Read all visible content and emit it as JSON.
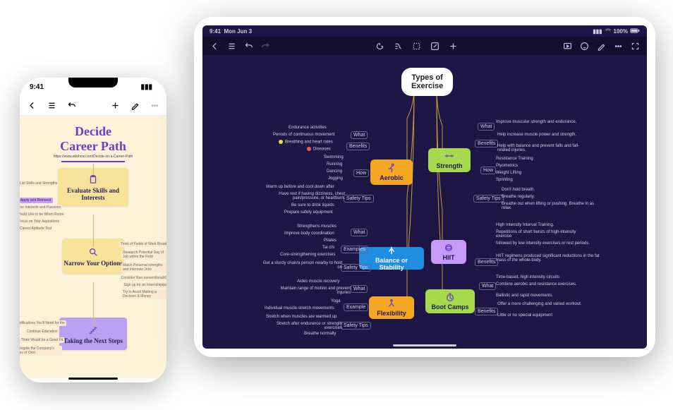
{
  "phone": {
    "status": {
      "time": "9:41"
    },
    "canvas": {
      "title_l1": "Decide",
      "title_l2": "Career Path",
      "url": "https://www.wikihow.com/Decide-on-a-Career-Path",
      "nodes": {
        "n1": "Evaluate Skills and Interests",
        "n2": "Narrow Your Options",
        "n3": "Taking the Next Steps"
      },
      "left": [
        "List Skills and Strengths",
        "Your Interests and Passions",
        "Would Like to be When Retire",
        "Focus on Your Aspirations",
        "Career Aptitude Test"
      ],
      "left_pill": "Apply and Reinvest",
      "right_n2": [
        "Think of Fields of Work Broadly",
        "Research Potential Day of Job within the Field",
        "Match Personal strengths and Interests Jobs",
        "Consider Non-conventional/Go",
        "Sign up for an Internship/part",
        "Try to Avoid Making a Decision & Money"
      ],
      "left_n3": [
        "Continue Education",
        "Qualifications You'll Need for the",
        "You Think Would be a Good Fit",
        "Interrogate the Company's Values of Own"
      ]
    }
  },
  "tablet": {
    "status": {
      "time": "9:41",
      "date": "Mon Jun 3",
      "battery": "100%"
    },
    "canvas": {
      "root_l1": "Types of",
      "root_l2": "Exercise",
      "branches": {
        "aerobic": {
          "label": "Aerobic",
          "what": [
            "Endurance activities",
            "Periods of continuous movement"
          ],
          "benefits": [
            "Breathing and heart rates",
            "Diseases"
          ],
          "how": [
            "Swimming",
            "Running",
            "Dancing",
            "Jogging"
          ],
          "safety": [
            "Warm up before and cool down after",
            "Have rest if having dizziness, chest pain/pressure, or heartburn.",
            "Be sure to drink liquids",
            "Prepare safety equipment"
          ]
        },
        "balance": {
          "label": "Balance or Stability",
          "what": [
            "Strengthens muscles",
            "Improve body coordination"
          ],
          "examples": [
            "Pilates",
            "Tai chi",
            "Core-strengthening exercises"
          ],
          "safety": [
            "Get a sturdy chair/a person nearby to hold on"
          ]
        },
        "flexibility": {
          "label": "Flexibility",
          "what": [
            "Aides muscle recovery",
            "Maintain range of motion and prevent injuries"
          ],
          "example": [
            "Yoga",
            "Individual muscle-stretch movements"
          ],
          "safety": [
            "Stretch when muscles are warmed up",
            "Stretch after endurance or strength exercises",
            "Breathe normally"
          ]
        },
        "strength": {
          "label": "Strength",
          "what": [
            "Improve muscular strength and endurance."
          ],
          "benefits": [
            "Help increase muscle power and strength.",
            "Help with balance and prevent falls and fall-related injuries."
          ],
          "how": [
            "Resistance Training",
            "Plyometrics",
            "Weight Lifting",
            "Sprinting"
          ],
          "safety": [
            "Don't hold breath.",
            "Breathe regularly.",
            "Breathe out when lifting or pushing. Breathe in as relax."
          ]
        },
        "hiit": {
          "label": "HIIT",
          "items": [
            "High Intensity Interval Training.",
            "Repetitions of short bursts of high-intensity exercise",
            "followed by low intensity exercises or rest periods.",
            "HIIT regimens produced significant reductions in the fat mass of the whole-body."
          ]
        },
        "bootcamps": {
          "label": "Boot Camps",
          "what": [
            "Time-based, high intensity circuits",
            "Combine aerobic and resistance exercises.",
            "Ballistic and rapid movements"
          ],
          "benefits": [
            "Offer a more challenging and varied workout.",
            "Little or no special equipment"
          ]
        }
      },
      "subcaps": {
        "what": "What",
        "benefits": "Benefits",
        "how": "How",
        "safety": "Safety Tips",
        "examples": "Examples",
        "example": "Example"
      }
    }
  }
}
